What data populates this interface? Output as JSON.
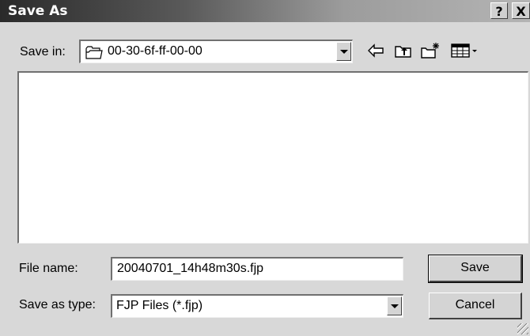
{
  "window": {
    "title": "Save As",
    "help_label": "?",
    "close_label": "X"
  },
  "toolbar": {
    "save_in_label": "Save in:",
    "save_in_value": "00-30-6f-ff-00-00",
    "folder_icon": "folder-icon",
    "back_icon": "back-arrow-icon",
    "up_icon": "up-one-level-icon",
    "new_folder_icon": "new-folder-icon",
    "views_icon": "view-menu-icon"
  },
  "file_list": {
    "items": []
  },
  "footer": {
    "file_name_label": "File name:",
    "file_name_value": "20040701_14h48m30s.fjp",
    "save_as_type_label": "Save as type:",
    "save_as_type_value": "FJP Files (*.fjp)",
    "save_label": "Save",
    "cancel_label": "Cancel"
  }
}
